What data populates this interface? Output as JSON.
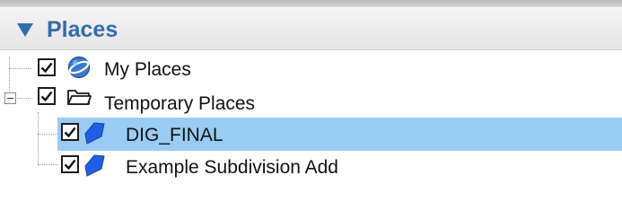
{
  "panel": {
    "title": "Places",
    "accent_color": "#2f6cb3"
  },
  "tree": {
    "items": [
      {
        "label": "My Places",
        "checked": true,
        "icon": "earth-globe-icon"
      },
      {
        "label": "Temporary Places",
        "checked": true,
        "icon": "folder-icon",
        "expanded": true
      },
      {
        "label": "DIG_FINAL",
        "checked": true,
        "icon": "polygon-icon",
        "selected": true
      },
      {
        "label": "Example Subdivision Add",
        "checked": true,
        "icon": "polygon-icon"
      }
    ]
  },
  "colors": {
    "selection": "#99ccf3",
    "polygon": "#1f5fe8"
  }
}
